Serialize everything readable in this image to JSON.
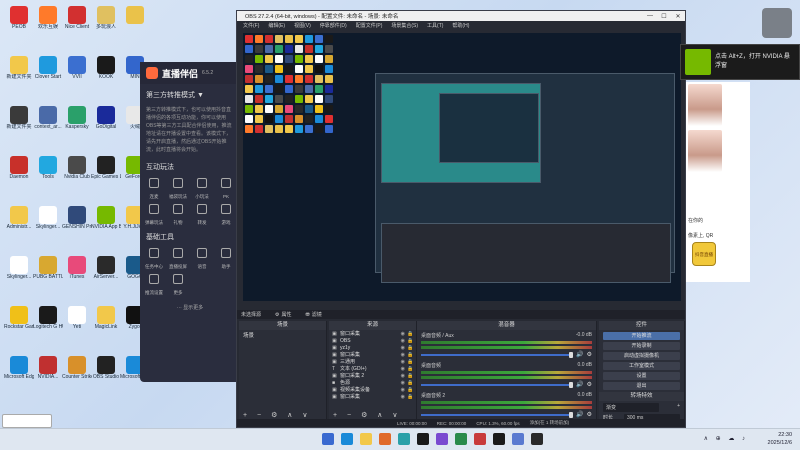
{
  "desktop": {
    "icons": [
      {
        "label": "PEOB",
        "color": "#e03030"
      },
      {
        "label": "欢乐互娱",
        "color": "#ff7a2a"
      },
      {
        "label": "Nice Client",
        "color": "#d23030"
      },
      {
        "label": "多玩浪人",
        "color": "#e0c060"
      },
      {
        "label": "",
        "color": "#eac24a"
      },
      {
        "label": "新建文件夹",
        "color": "#f2c84a"
      },
      {
        "label": "Clover Start",
        "color": "#1f9ade"
      },
      {
        "label": "VVII",
        "color": "#3b6fd0"
      },
      {
        "label": "KOOK",
        "color": "#1a1a1a"
      },
      {
        "label": "MIN",
        "color": "#3366cc"
      },
      {
        "label": "新建文件夹",
        "color": "#3a3a3a"
      },
      {
        "label": "context_ar...",
        "color": "#4a6aa8"
      },
      {
        "label": "Kaspersky",
        "color": "#2aa06a"
      },
      {
        "label": "GoDigital",
        "color": "#1a2a9a"
      },
      {
        "label": "火绒",
        "color": "#e8e8e8"
      },
      {
        "label": "Daemon",
        "color": "#c8302a"
      },
      {
        "label": "Tools",
        "color": "#22a8e0"
      },
      {
        "label": "Nvidia Club",
        "color": "#4a4a4a"
      },
      {
        "label": "Epic Games Launcher",
        "color": "#222"
      },
      {
        "label": "GeForce",
        "color": "#76b900"
      },
      {
        "label": "Administr...",
        "color": "#f2c84a"
      },
      {
        "label": "Skylinger...",
        "color": "#ffffff"
      },
      {
        "label": "GENSHIN Protocol",
        "color": "#304a7a"
      },
      {
        "label": "NVIDIA App Beta",
        "color": "#76b900"
      },
      {
        "label": "Y.H.JiJiem",
        "color": "#f2c84a"
      },
      {
        "label": "Skylinger...",
        "color": "#ffffff"
      },
      {
        "label": "PUBG BATTLEGR...",
        "color": "#d8a830"
      },
      {
        "label": "iTunes",
        "color": "#e84a7a"
      },
      {
        "label": "AirServer...",
        "color": "#2a2a2a"
      },
      {
        "label": "GOGO",
        "color": "#1a5a8a"
      },
      {
        "label": "Rockstar Games",
        "color": "#f0c018"
      },
      {
        "label": "Logitech G HUB",
        "color": "#1a1a1a"
      },
      {
        "label": "Yeti",
        "color": "#ffffff"
      },
      {
        "label": "MagicLink",
        "color": "#f2c84a"
      },
      {
        "label": "Zygor",
        "color": "#111"
      },
      {
        "label": "Microsoft Edge",
        "color": "#1a8ad8"
      },
      {
        "label": "NVIDIA...",
        "color": "#c03030"
      },
      {
        "label": "Counter Strike Global Off.",
        "color": "#d8902a"
      },
      {
        "label": "OBS Studio",
        "color": "#222"
      },
      {
        "label": "Microsoft Edge",
        "color": "#1a8ad8"
      }
    ]
  },
  "companion": {
    "title": "直播伴侣",
    "version": "6.5.2",
    "mode_label": "第三方转推模式 ▼",
    "description": "第三方转推模式下，也可以使用抖音直播伴侣的各项互动功能，你可以使用OBS等第三方工具配合伴侣使用，推流地址请在开播设置中查看。该模式下，请先开启直播，然后通过OBS开始推流，此时直播将会开始。",
    "section_interact": "互动玩法",
    "interact_items": [
      "连麦",
      "福袋玩法",
      "小玩法",
      "PK",
      "弹幕玩法",
      "礼物",
      "转发",
      "游戏"
    ],
    "section_tools": "基础工具",
    "tool_items": [
      "任务中心",
      "直播投屏",
      "语音",
      "助手",
      "推流设置",
      "更多"
    ],
    "more_label": "··· 显示更多"
  },
  "obs": {
    "title": "OBS 27.2.4 (64-bit, windows) - 配置文件: 未命名 - 场景: 未命名",
    "menu": [
      "文件(F)",
      "编辑(E)",
      "视图(V)",
      "停靠部件(D)",
      "配置文件(P)",
      "场景集合(S)",
      "工具(T)",
      "帮助(H)"
    ],
    "source_bar": {
      "source_tab": "未选择源",
      "props": "属性",
      "filters": "滤镜"
    },
    "scenes": {
      "header": "场景",
      "items": [
        "场景"
      ]
    },
    "sources": {
      "header": "来源",
      "items": [
        {
          "name": "窗口采集",
          "icon": "▣"
        },
        {
          "name": "OBS",
          "icon": "▣"
        },
        {
          "name": "yz1y",
          "icon": "▣"
        },
        {
          "name": "窗口采集",
          "icon": "▣"
        },
        {
          "name": "三通用",
          "icon": "▣"
        },
        {
          "name": "文本 (GDI+)",
          "icon": "T"
        },
        {
          "name": "窗口采集 2",
          "icon": "▣"
        },
        {
          "name": "色源",
          "icon": "■"
        },
        {
          "name": "视频采集设备",
          "icon": "▣"
        },
        {
          "name": "窗口采集",
          "icon": "▣"
        }
      ]
    },
    "mixer": {
      "header": "混音器",
      "channels": [
        {
          "name": "桌面音频 / Aux",
          "level": "-0.0 dB"
        },
        {
          "name": "桌面音频",
          "level": "0.0 dB"
        },
        {
          "name": "桌面音频 2",
          "level": "0.0 dB"
        }
      ]
    },
    "controls": {
      "header": "控件",
      "buttons": [
        "开始推流",
        "开始录制",
        "启动虚拟摄像机",
        "工作室模式",
        "设置",
        "退出"
      ],
      "transition_header": "转场特效",
      "transition_label": "渐变",
      "duration_label": "时长",
      "duration_value": "300 ms"
    },
    "status": {
      "live": "LIVE: 00:00:00",
      "rec": "REC: 00:00:00",
      "cpu": "CPU: 1.3%, 60.00 fps",
      "scene_hint": "添加(在 1 转场前加)"
    }
  },
  "nvidia_popup": {
    "text1": "点击 Alt+Z，打开 NVIDIA 悬",
    "text2": "浮窗"
  },
  "browser": {
    "text1": "在你的",
    "text2": "像素上, QR",
    "badge": "抖音直播"
  },
  "taskbar": {
    "icons": [
      "#3a6ad0",
      "#1a8ad8",
      "#f2c84a",
      "#e06a2a",
      "#2aa0a8",
      "#1a1a1a",
      "#7a4ad0",
      "#2a8a4a",
      "#c83a3a",
      "#1a1a1a",
      "#5a7ad0",
      "#2a2a2a"
    ],
    "tray": "∧ ⊕ ☁ ♪",
    "time": "22:30",
    "date": "2025/12/6"
  }
}
